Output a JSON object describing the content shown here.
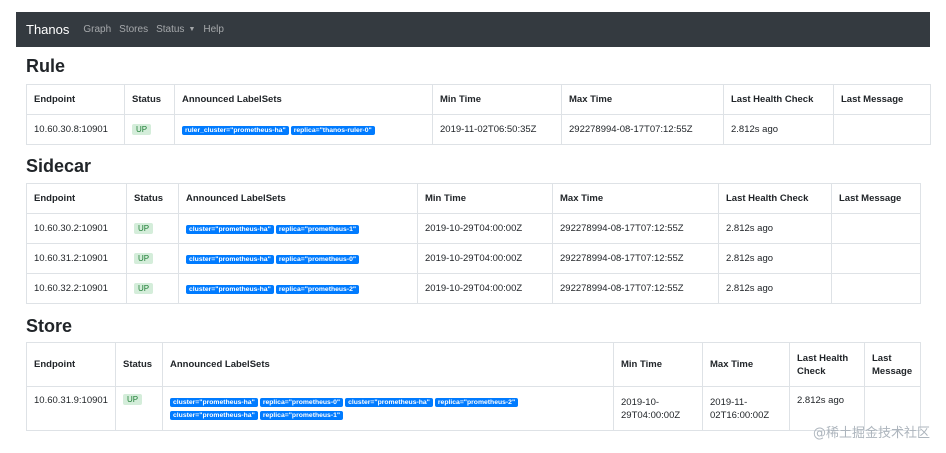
{
  "navbar": {
    "brand": "Thanos",
    "items": [
      "Graph",
      "Stores",
      "Status",
      "Help"
    ]
  },
  "headers": {
    "endpoint": "Endpoint",
    "status": "Status",
    "labelsets": "Announced LabelSets",
    "min_time": "Min Time",
    "max_time": "Max Time",
    "health": "Last Health Check",
    "message": "Last Message",
    "health_line1": "Last Health",
    "health_line2": "Check",
    "message_line1": "Last",
    "message_line2": "Message"
  },
  "rule": {
    "title": "Rule",
    "rows": [
      {
        "endpoint": "10.60.30.8:10901",
        "status": "UP",
        "labels": [
          "ruler_cluster=\"prometheus-ha\"",
          "replica=\"thanos-ruler-0\""
        ],
        "min_time": "2019-11-02T06:50:35Z",
        "max_time": "292278994-08-17T07:12:55Z",
        "health": "2.812s ago",
        "message": ""
      }
    ]
  },
  "sidecar": {
    "title": "Sidecar",
    "rows": [
      {
        "endpoint": "10.60.30.2:10901",
        "status": "UP",
        "labels": [
          "cluster=\"prometheus-ha\"",
          "replica=\"prometheus-1\""
        ],
        "min_time": "2019-10-29T04:00:00Z",
        "max_time": "292278994-08-17T07:12:55Z",
        "health": "2.812s ago",
        "message": ""
      },
      {
        "endpoint": "10.60.31.2:10901",
        "status": "UP",
        "labels": [
          "cluster=\"prometheus-ha\"",
          "replica=\"prometheus-0\""
        ],
        "min_time": "2019-10-29T04:00:00Z",
        "max_time": "292278994-08-17T07:12:55Z",
        "health": "2.812s ago",
        "message": ""
      },
      {
        "endpoint": "10.60.32.2:10901",
        "status": "UP",
        "labels": [
          "cluster=\"prometheus-ha\"",
          "replica=\"prometheus-2\""
        ],
        "min_time": "2019-10-29T04:00:00Z",
        "max_time": "292278994-08-17T07:12:55Z",
        "health": "2.812s ago",
        "message": ""
      }
    ]
  },
  "store": {
    "title": "Store",
    "rows": [
      {
        "endpoint": "10.60.31.9:10901",
        "status": "UP",
        "labels": [
          "cluster=\"prometheus-ha\"",
          "replica=\"prometheus-0\"",
          "cluster=\"prometheus-ha\"",
          "replica=\"prometheus-2\"",
          "cluster=\"prometheus-ha\"",
          "replica=\"prometheus-1\""
        ],
        "min_time_line1": "2019-10-",
        "min_time_line2": "29T04:00:00Z",
        "max_time_line1": "2019-11-",
        "max_time_line2": "02T16:00:00Z",
        "health": "2.812s ago",
        "message": ""
      }
    ]
  },
  "watermark": "@稀土掘金技术社区",
  "colors": {
    "navbar": "#343a40",
    "label_badge": "#007bff",
    "up_badge_bg": "#d4edda",
    "up_badge_text": "#1e7e34"
  }
}
